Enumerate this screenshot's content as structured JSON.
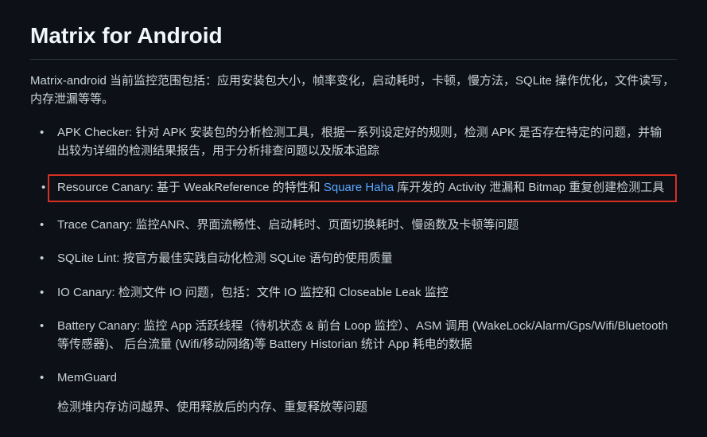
{
  "heading": "Matrix for Android",
  "intro": "Matrix-android 当前监控范围包括：应用安装包大小，帧率变化，启动耗时，卡顿，慢方法，SQLite 操作优化，文件读写，内存泄漏等等。",
  "items": [
    {
      "text": "APK Checker: 针对 APK 安装包的分析检测工具，根据一系列设定好的规则，检测 APK 是否存在特定的问题，并输出较为详细的检测结果报告，用于分析排查问题以及版本追踪"
    },
    {
      "prefix": "Resource Canary: 基于 WeakReference 的特性和 ",
      "link": "Square Haha",
      "suffix": " 库开发的 Activity 泄漏和 Bitmap 重复创建检测工具",
      "highlighted": true
    },
    {
      "text": "Trace Canary: 监控ANR、界面流畅性、启动耗时、页面切换耗时、慢函数及卡顿等问题"
    },
    {
      "text": "SQLite Lint: 按官方最佳实践自动化检测 SQLite 语句的使用质量"
    },
    {
      "text": "IO Canary: 检测文件 IO 问题，包括：文件 IO 监控和 Closeable Leak 监控"
    },
    {
      "text": "Battery Canary: 监控 App 活跃线程（待机状态 & 前台 Loop 监控）、ASM 调用 (WakeLock/Alarm/Gps/Wifi/Bluetooth 等传感器)、 后台流量 (Wifi/移动网络)等 Battery Historian 统计 App 耗电的数据"
    },
    {
      "text": "MemGuard",
      "subtext": "检测堆内存访问越界、使用释放后的内存、重复释放等问题"
    }
  ]
}
